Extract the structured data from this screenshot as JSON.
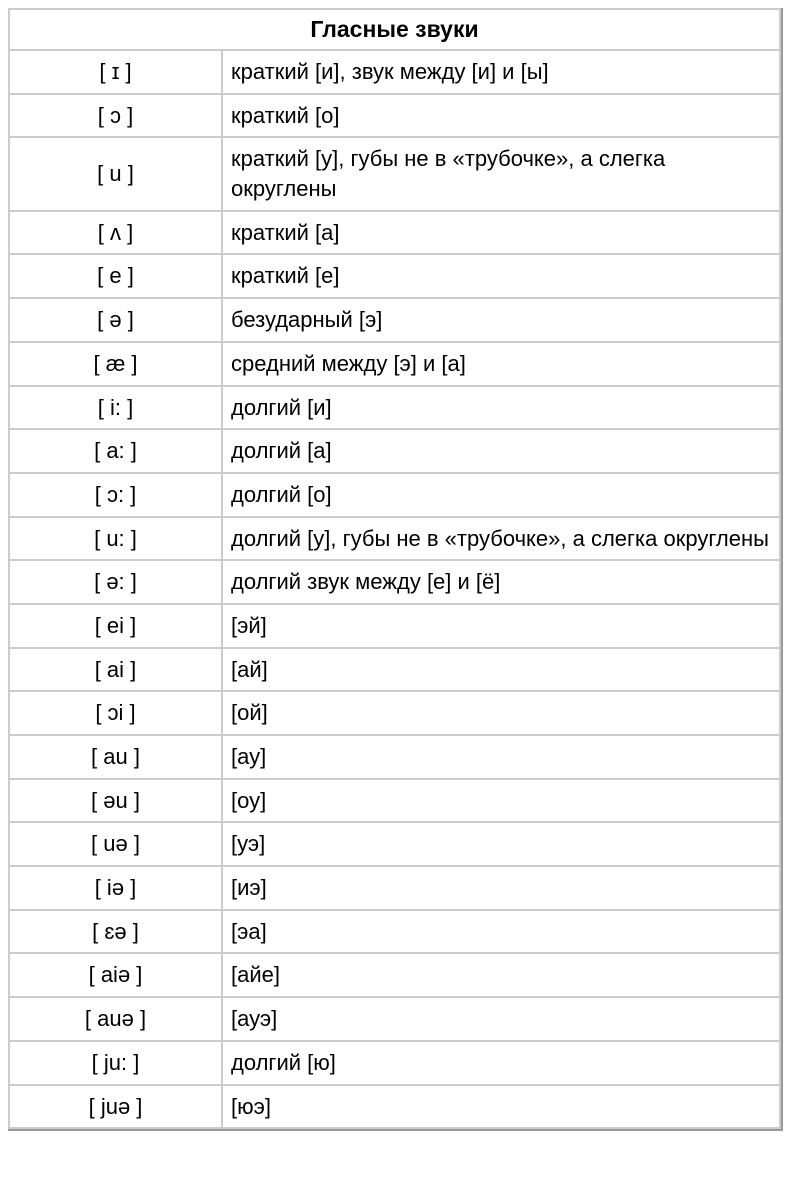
{
  "table": {
    "title": "Гласные звуки",
    "rows": [
      {
        "symbol": "[ ɪ ]",
        "desc": "краткий [и], звук между [и] и [ы]"
      },
      {
        "symbol": "[ ɔ ]",
        "desc": "краткий [о]"
      },
      {
        "symbol": "[ u ]",
        "desc": "краткий [у], губы не в «трубочке», а слегка округлены"
      },
      {
        "symbol": "[ ʌ ]",
        "desc": "краткий [а]"
      },
      {
        "symbol": "[ e ]",
        "desc": "краткий [е]"
      },
      {
        "symbol": "[ ə ]",
        "desc": "безударный [э]"
      },
      {
        "symbol": "[ æ ]",
        "desc": "средний между [э] и [а]"
      },
      {
        "symbol": "[ i: ]",
        "desc": "долгий [и]"
      },
      {
        "symbol": "[ a: ]",
        "desc": "долгий [а]"
      },
      {
        "symbol": "[ ɔ: ]",
        "desc": "долгий [о]"
      },
      {
        "symbol": "[ u: ]",
        "desc": "долгий [у], губы не в «трубочке», а слегка округлены"
      },
      {
        "symbol": "[ ə: ]",
        "desc": "долгий звук между [е] и [ё]"
      },
      {
        "symbol": "[ ei ]",
        "desc": "[эй]"
      },
      {
        "symbol": "[ ai ]",
        "desc": "[ай]"
      },
      {
        "symbol": "[ ɔi ]",
        "desc": "[ой]"
      },
      {
        "symbol": "[ au ]",
        "desc": "[ау]"
      },
      {
        "symbol": "[ əu ]",
        "desc": "[оу]"
      },
      {
        "symbol": "[ uə ]",
        "desc": "[уэ]"
      },
      {
        "symbol": "[ iə ]",
        "desc": "[иэ]"
      },
      {
        "symbol": "[ ɛə ]",
        "desc": "[эа]"
      },
      {
        "symbol": "[ aiə ]",
        "desc": "[айе]"
      },
      {
        "symbol": "[ auə ]",
        "desc": "[ауэ]"
      },
      {
        "symbol": "[ ju: ]",
        "desc": "долгий [ю]"
      },
      {
        "symbol": "[ juə ]",
        "desc": "[юэ]"
      }
    ]
  }
}
